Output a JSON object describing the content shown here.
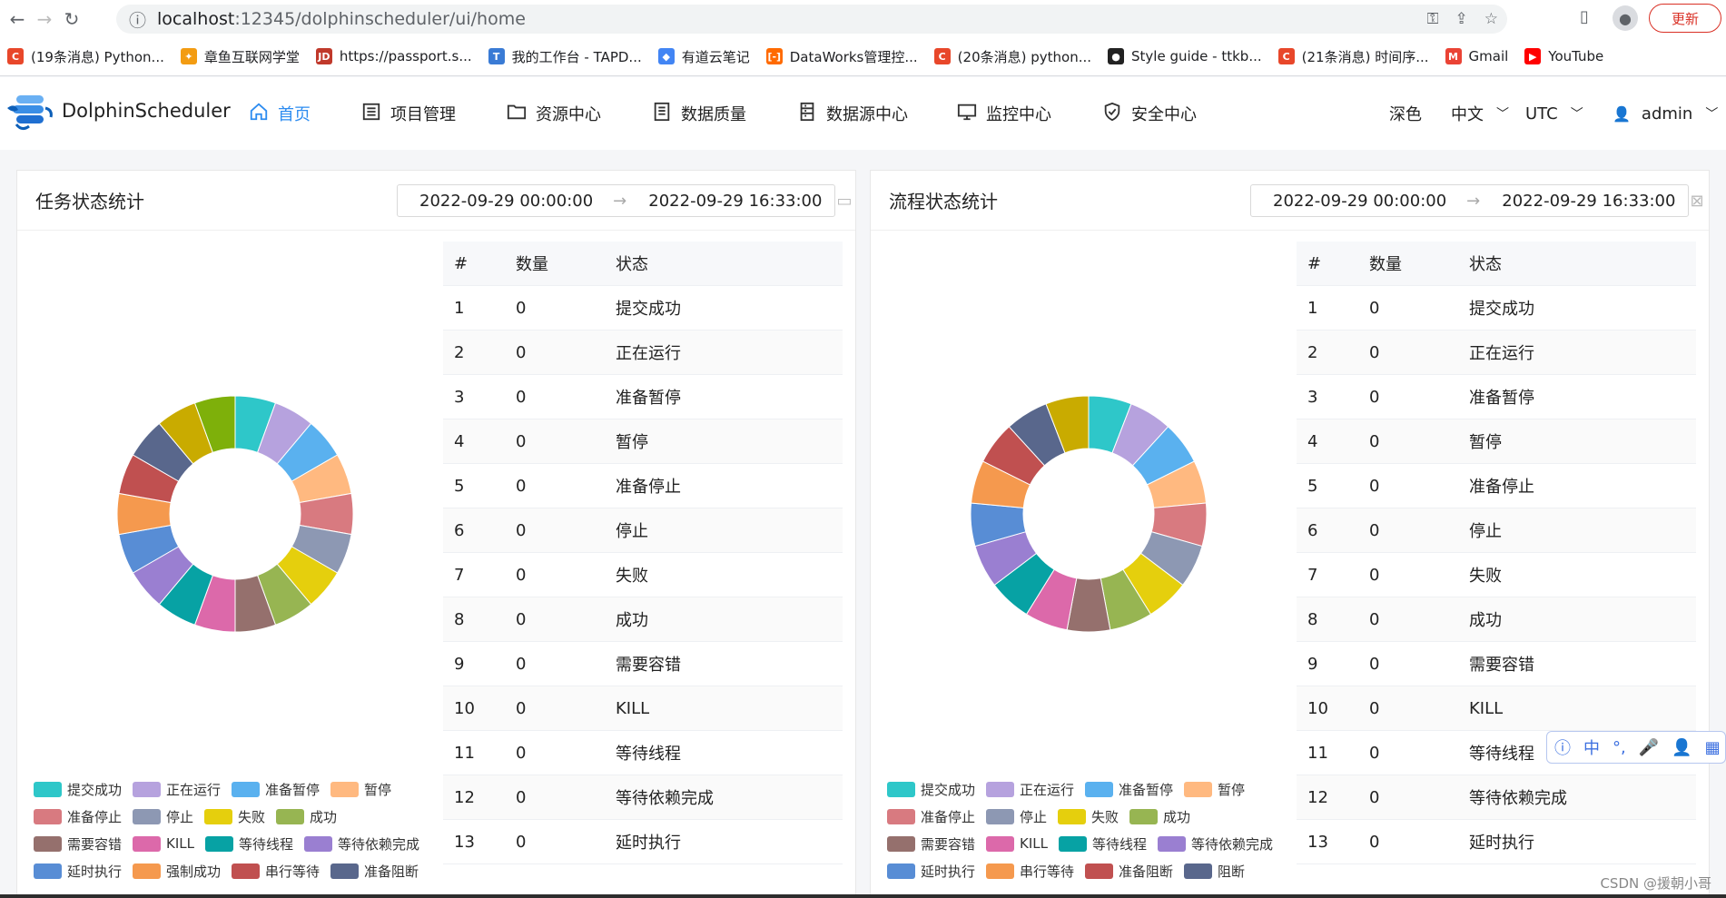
{
  "browser": {
    "url_host": "localhost",
    "url_path": ":12345/dolphinscheduler/ui/home",
    "update_label": "更新"
  },
  "bookmarks": [
    {
      "label": "(19条消息) Python...",
      "color": "#e8472a",
      "glyph": "C"
    },
    {
      "label": "章鱼互联网学堂",
      "color": "#f39c12",
      "glyph": "✦"
    },
    {
      "label": "https://passport.s...",
      "color": "#c0392b",
      "glyph": "JD"
    },
    {
      "label": "我的工作台 - TAPD...",
      "color": "#3a7bd5",
      "glyph": "T"
    },
    {
      "label": "有道云笔记",
      "color": "#4285f4",
      "glyph": "◆"
    },
    {
      "label": "DataWorks管理控...",
      "color": "#ff6a00",
      "glyph": "[-]"
    },
    {
      "label": "(20条消息) python...",
      "color": "#e8472a",
      "glyph": "C"
    },
    {
      "label": "Style guide - ttkb...",
      "color": "#222222",
      "glyph": "●"
    },
    {
      "label": "(21条消息) 时间序...",
      "color": "#e8472a",
      "glyph": "C"
    },
    {
      "label": "Gmail",
      "color": "#ea4335",
      "glyph": "M"
    },
    {
      "label": "YouTube",
      "color": "#ff0000",
      "glyph": "▶"
    }
  ],
  "app": {
    "logo_text": "DolphinScheduler",
    "menu": [
      {
        "label": "首页",
        "icon": "home-icon"
      },
      {
        "label": "项目管理",
        "icon": "list-icon"
      },
      {
        "label": "资源中心",
        "icon": "folder-icon"
      },
      {
        "label": "数据质量",
        "icon": "document-icon"
      },
      {
        "label": "数据源中心",
        "icon": "database-icon"
      },
      {
        "label": "监控中心",
        "icon": "monitor-icon"
      },
      {
        "label": "安全中心",
        "icon": "shield-icon"
      }
    ],
    "theme_label": "深色",
    "lang_label": "中文",
    "tz_label": "UTC",
    "user_label": "admin"
  },
  "task_panel": {
    "title": "任务状态统计",
    "start": "2022-09-29 00:00:00",
    "end": "2022-09-29 16:33:00"
  },
  "process_panel": {
    "title": "流程状态统计",
    "start": "2022-09-29 00:00:00",
    "end": "2022-09-29 16:33:00"
  },
  "table": {
    "headers": [
      "#",
      "数量",
      "状态"
    ],
    "rows": [
      [
        "1",
        "0",
        "提交成功"
      ],
      [
        "2",
        "0",
        "正在运行"
      ],
      [
        "3",
        "0",
        "准备暂停"
      ],
      [
        "4",
        "0",
        "暂停"
      ],
      [
        "5",
        "0",
        "准备停止"
      ],
      [
        "6",
        "0",
        "停止"
      ],
      [
        "7",
        "0",
        "失败"
      ],
      [
        "8",
        "0",
        "成功"
      ],
      [
        "9",
        "0",
        "需要容错"
      ],
      [
        "10",
        "0",
        "KILL"
      ],
      [
        "11",
        "0",
        "等待线程"
      ],
      [
        "12",
        "0",
        "等待依赖完成"
      ],
      [
        "13",
        "0",
        "延时执行"
      ]
    ]
  },
  "task_legend": [
    {
      "label": "提交成功",
      "color": "#2ec7c9"
    },
    {
      "label": "正在运行",
      "color": "#b6a2de"
    },
    {
      "label": "准备暂停",
      "color": "#5ab1ef"
    },
    {
      "label": "暂停",
      "color": "#ffb980"
    },
    {
      "label": "准备停止",
      "color": "#d87a80"
    },
    {
      "label": "停止",
      "color": "#8d98b3"
    },
    {
      "label": "失败",
      "color": "#e5cf0d"
    },
    {
      "label": "成功",
      "color": "#97b552"
    },
    {
      "label": "需要容错",
      "color": "#95706d"
    },
    {
      "label": "KILL",
      "color": "#dc69aa"
    },
    {
      "label": "等待线程",
      "color": "#07a2a4"
    },
    {
      "label": "等待依赖完成",
      "color": "#9a7fd1"
    },
    {
      "label": "延时执行",
      "color": "#588dd5"
    },
    {
      "label": "强制成功",
      "color": "#f5994e"
    },
    {
      "label": "串行等待",
      "color": "#c05050"
    },
    {
      "label": "准备阻断",
      "color": "#59678c"
    }
  ],
  "process_legend": [
    {
      "label": "提交成功",
      "color": "#2ec7c9"
    },
    {
      "label": "正在运行",
      "color": "#b6a2de"
    },
    {
      "label": "准备暂停",
      "color": "#5ab1ef"
    },
    {
      "label": "暂停",
      "color": "#ffb980"
    },
    {
      "label": "准备停止",
      "color": "#d87a80"
    },
    {
      "label": "停止",
      "color": "#8d98b3"
    },
    {
      "label": "失败",
      "color": "#e5cf0d"
    },
    {
      "label": "成功",
      "color": "#97b552"
    },
    {
      "label": "需要容错",
      "color": "#95706d"
    },
    {
      "label": "KILL",
      "color": "#dc69aa"
    },
    {
      "label": "等待线程",
      "color": "#07a2a4"
    },
    {
      "label": "等待依赖完成",
      "color": "#9a7fd1"
    },
    {
      "label": "延时执行",
      "color": "#588dd5"
    },
    {
      "label": "串行等待",
      "color": "#f5994e"
    },
    {
      "label": "准备阻断",
      "color": "#c05050"
    },
    {
      "label": "阻断",
      "color": "#59678c"
    }
  ],
  "task_donut_colors": [
    "#2ec7c9",
    "#b6a2de",
    "#5ab1ef",
    "#ffb980",
    "#d87a80",
    "#8d98b3",
    "#e5cf0d",
    "#97b552",
    "#95706d",
    "#dc69aa",
    "#07a2a4",
    "#9a7fd1",
    "#588dd5",
    "#f5994e",
    "#c05050",
    "#59678c",
    "#c9ab00",
    "#7eb00a"
  ],
  "process_donut_colors": [
    "#2ec7c9",
    "#b6a2de",
    "#5ab1ef",
    "#ffb980",
    "#d87a80",
    "#8d98b3",
    "#e5cf0d",
    "#97b552",
    "#95706d",
    "#dc69aa",
    "#07a2a4",
    "#9a7fd1",
    "#588dd5",
    "#f5994e",
    "#c05050",
    "#59678c",
    "#c9ab00"
  ],
  "watermark": "CSDN @援朝小哥"
}
